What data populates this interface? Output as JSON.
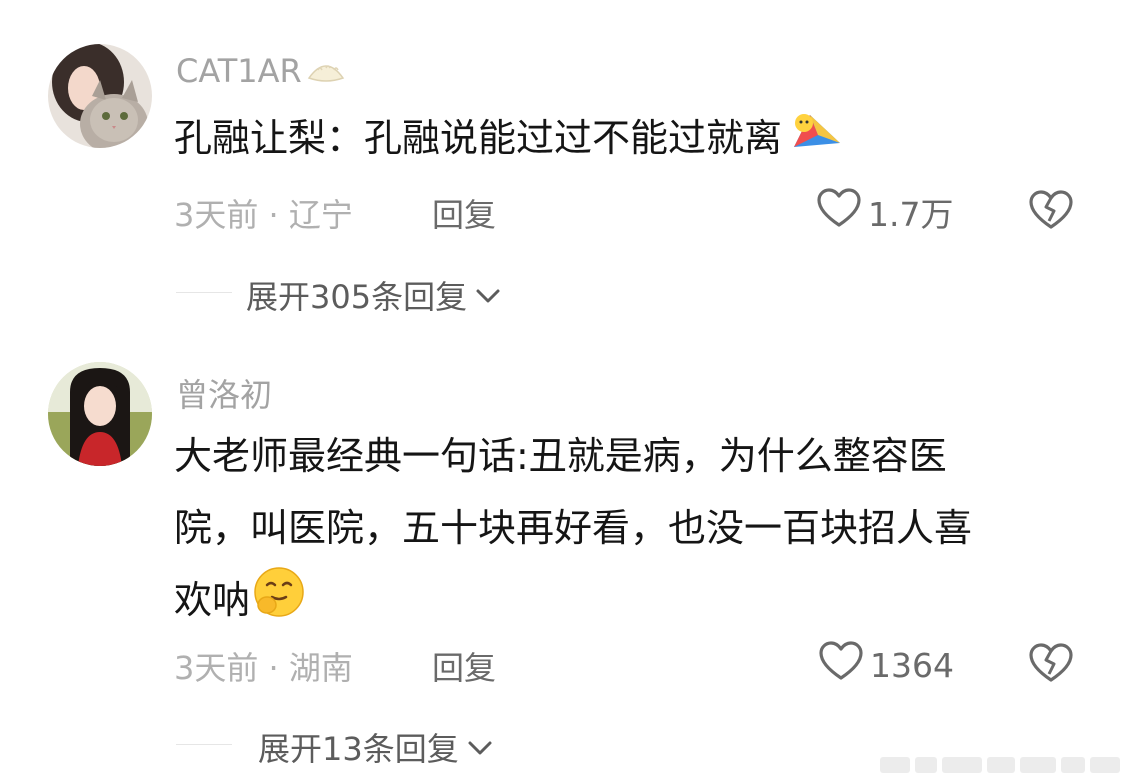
{
  "comments": [
    {
      "username": "CAT1AR",
      "username_emoji": "dumpling-emoji",
      "content": "孔融让梨：孔融说能过过不能过就离",
      "content_emoji": "kite-emoji",
      "time": "3天前",
      "location": "辽宁",
      "meta": "3天前 · 辽宁",
      "reply_label": "回复",
      "like_count": "1.7万",
      "expand_label": "展开305条回复",
      "avatar": "cat-avatar"
    },
    {
      "username": "曾洛初",
      "content_lines": [
        "大老师最经典一句话:丑就是病，为什么整容医",
        "院，叫医院，五十块再好看，也没一百块招人喜",
        "欢呐"
      ],
      "content_emoji": "shy-smile-emoji",
      "time": "3天前",
      "location": "湖南",
      "meta": "3天前 · 湖南",
      "reply_label": "回复",
      "like_count": "1364",
      "expand_label": "展开13条回复",
      "avatar": "girl-avatar"
    }
  ],
  "colors": {
    "username": "#a3a3a3",
    "content": "#151515",
    "meta": "#b0b0b0",
    "action": "#6a6a6a"
  },
  "icons": [
    "heart-outline-icon",
    "broken-heart-icon",
    "chevron-down-icon"
  ]
}
